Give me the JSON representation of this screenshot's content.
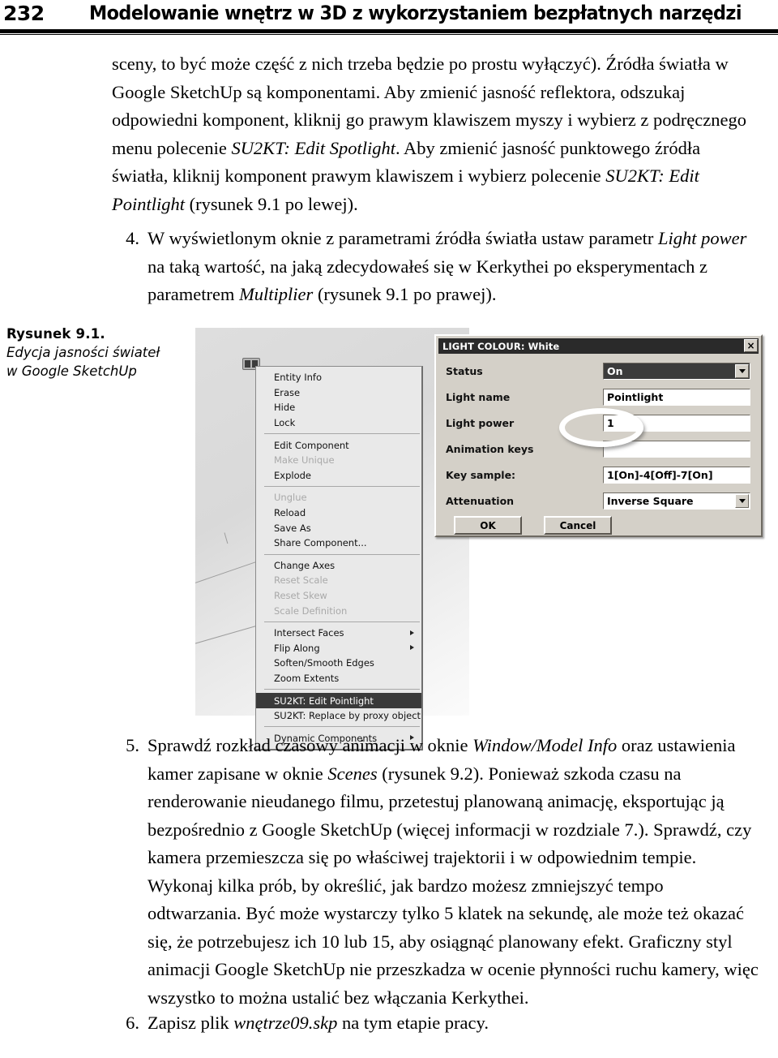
{
  "running_head": {
    "page_number": "232",
    "title": "Modelowanie wnętrz w 3D z wykorzystaniem bezpłatnych narzędzi"
  },
  "body": {
    "intro_paragraph": {
      "t1": "sceny, to być może część z nich trzeba będzie po prostu wyłączyć). Źródła światła w Google SketchUp są komponentami. Aby zmienić jasność reflektora, odszukaj odpowiedni komponent, kliknij go prawym klawiszem myszy i wybierz z podręcznego menu polecenie ",
      "i1": "SU2KT: Edit Spotlight",
      "t2": ". Aby zmienić jasność punktowego źródła światła, kliknij komponent prawym klawiszem i wybierz polecenie ",
      "i2": "SU2KT: Edit Pointlight",
      "t3": " (rysunek 9.1 po lewej)."
    },
    "item_4": {
      "number": "4.",
      "t1": "W wyświetlonym oknie z parametrami źródła światła ustaw parametr ",
      "i1": "Light power",
      "t2": " na taką wartość, na jaką zdecydowałeś się w Kerkythei po eksperymentach z parametrem ",
      "i2": "Multiplier",
      "t3": " (rysunek 9.1 po prawej)."
    },
    "item_5": {
      "number": "5.",
      "t1": "Sprawdź rozkład czasowy animacji w oknie ",
      "i1": "Window/Model Info",
      "t2": " oraz ustawienia kamer zapisane w oknie ",
      "i2": "Scenes",
      "t3": " (rysunek 9.2). Ponieważ szkoda czasu na renderowanie nieudanego filmu, przetestuj planowaną animację, eksportując ją bezpośrednio z Google SketchUp (więcej informacji w rozdziale 7.). Sprawdź, czy kamera przemieszcza się po właściwej trajektorii i w odpowiednim tempie. Wykonaj kilka prób, by określić, jak bardzo możesz zmniejszyć tempo odtwarzania. Być może wystarczy tylko 5 klatek na sekundę, ale może też okazać się, że potrzebujesz ich 10 lub 15, aby osiągnąć planowany efekt. Graficzny styl animacji Google SketchUp nie przeszkadza w ocenie płynności ruchu kamery, więc wszystko to można ustalić bez włączania Kerkythei."
    },
    "item_6": {
      "number": "6.",
      "t1": "Zapisz plik ",
      "i1": "wnętrze09.skp",
      "t2": " na tym etapie pracy."
    }
  },
  "figure": {
    "caption_label": "Rysunek 9.1.",
    "caption_text_line1": "Edycja jasności świateł",
    "caption_text_line2": "w Google SketchUp",
    "context_menu": {
      "items": [
        {
          "label": "Entity Info",
          "state": "enabled",
          "submenu": false
        },
        {
          "label": "Erase",
          "state": "enabled",
          "submenu": false
        },
        {
          "label": "Hide",
          "state": "enabled",
          "submenu": false
        },
        {
          "label": "Lock",
          "state": "enabled",
          "submenu": false
        },
        {
          "label": "Edit Component",
          "state": "enabled",
          "submenu": false
        },
        {
          "label": "Make Unique",
          "state": "disabled",
          "submenu": false
        },
        {
          "label": "Explode",
          "state": "enabled",
          "submenu": false
        },
        {
          "label": "Unglue",
          "state": "disabled",
          "submenu": false
        },
        {
          "label": "Reload",
          "state": "enabled",
          "submenu": false
        },
        {
          "label": "Save As",
          "state": "enabled",
          "submenu": false
        },
        {
          "label": "Share Component...",
          "state": "enabled",
          "submenu": false
        },
        {
          "label": "Change Axes",
          "state": "enabled",
          "submenu": false
        },
        {
          "label": "Reset Scale",
          "state": "disabled",
          "submenu": false
        },
        {
          "label": "Reset Skew",
          "state": "disabled",
          "submenu": false
        },
        {
          "label": "Scale Definition",
          "state": "disabled",
          "submenu": false
        },
        {
          "label": "Intersect Faces",
          "state": "enabled",
          "submenu": true
        },
        {
          "label": "Flip Along",
          "state": "enabled",
          "submenu": true
        },
        {
          "label": "Soften/Smooth Edges",
          "state": "enabled",
          "submenu": false
        },
        {
          "label": "Zoom Extents",
          "state": "enabled",
          "submenu": false
        },
        {
          "label": "SU2KT: Edit Pointlight",
          "state": "selected",
          "submenu": false
        },
        {
          "label": "SU2KT: Replace by proxy object",
          "state": "enabled",
          "submenu": false
        },
        {
          "label": "Dynamic Components",
          "state": "enabled",
          "submenu": true
        }
      ]
    },
    "dialog": {
      "title": "LIGHT COLOUR: White",
      "close_label": "×",
      "fields": {
        "status_label": "Status",
        "status_value": "On",
        "light_name_label": "Light name",
        "light_name_value": "Pointlight",
        "light_power_label": "Light power",
        "light_power_value": "1",
        "animation_keys_label": "Animation keys",
        "animation_keys_value": "",
        "key_sample_label": "Key sample:",
        "key_sample_value": "1[On]-4[Off]-7[On]",
        "attenuation_label": "Attenuation",
        "attenuation_value": "Inverse Square"
      },
      "ok_label": "OK",
      "cancel_label": "Cancel"
    }
  }
}
